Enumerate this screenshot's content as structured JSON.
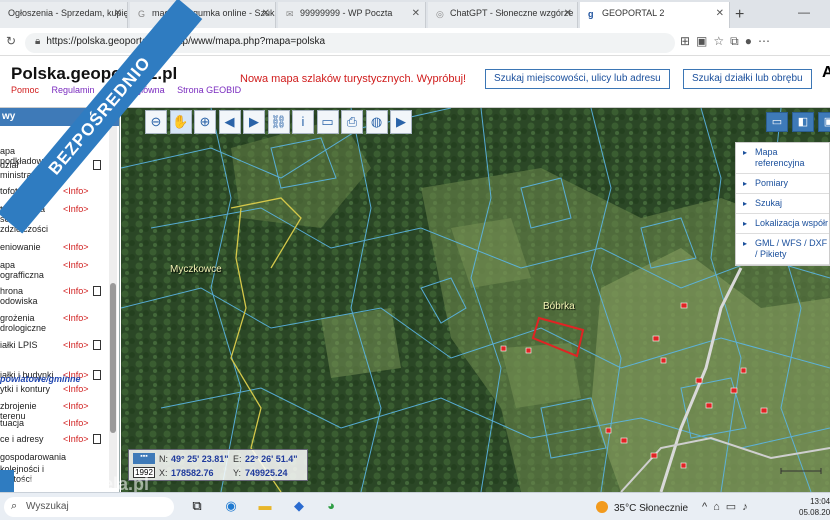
{
  "browser": {
    "tabs": [
      {
        "label": "Ogłoszenia - Sprzedam, kupię"
      },
      {
        "label": "magiczna gumka online - Szuk"
      },
      {
        "label": "99999999 - WP Poczta"
      },
      {
        "label": "ChatGPT - Słoneczne wzgórze"
      },
      {
        "label": "GEOPORTAL 2"
      }
    ],
    "new_tab": "+",
    "url": "https://polska.geoportal2.pl/map/www/mapa.php?mapa=polska"
  },
  "site": {
    "logo": "Polska.geoportal2.pl",
    "links": [
      "Pomoc",
      "Regulamin",
      "Strona główna",
      "Strona GEOBID"
    ],
    "promo": "Nowa mapa szlaków turystycznych. Wypróbuj!",
    "search_place_button": "Szukaj miejscowości, ulicy lub adresu",
    "search_parcel_button": "Szukaj działki lub obrębu",
    "header_extra": "A"
  },
  "left_panel": {
    "heading": "wy",
    "layers": [
      {
        "name": "apa podkładowa",
        "info": "<Info>",
        "doc": false
      },
      {
        "name": "dział\nministracyjny",
        "info": "",
        "doc": true
      },
      {
        "name": "tofotomapa",
        "info": "<Info>",
        "doc": false
      },
      {
        "name": "tofotomapa\nsokiej\nzdzielczości",
        "info": "<Info>",
        "doc": false
      },
      {
        "name": "eniowanie",
        "info": "<Info>",
        "doc": false
      },
      {
        "name": "apa\nografficzna",
        "info": "<Info>",
        "doc": false
      },
      {
        "name": "hrona\nodowiska",
        "info": "<Info>",
        "doc": true
      },
      {
        "name": "grożenia\ndrologiczne",
        "info": "<Info>",
        "doc": false
      },
      {
        "name": "iałki LPIS",
        "info": "<Info>",
        "doc": true
      },
      {
        "name": "iałki i budynki",
        "info": "<Info>",
        "doc": true
      },
      {
        "name": "ytki i kontury",
        "info": "<Info>",
        "doc": false
      },
      {
        "name": "zbrojenie terenu",
        "info": "<Info>",
        "doc": false
      },
      {
        "name": "tuacja",
        "info": "<Info>",
        "doc": false
      },
      {
        "name": "ce i adresy",
        "info": "<Info>",
        "doc": true
      },
      {
        "name": "gospodarowania",
        "info": "",
        "doc": false
      },
      {
        "name": "kolejności i\nzystości",
        "info": "",
        "doc": false
      }
    ],
    "section_label": "powiatowe/gminne"
  },
  "map": {
    "toolbar": [
      "zoom-out-icon",
      "hand-icon",
      "zoom-in-icon",
      "arrow-left-icon",
      "arrow-right-icon",
      "link-icon",
      "info-icon",
      "ruler-icon",
      "print-icon",
      "globe-icon",
      "camera-icon"
    ],
    "labels": {
      "village_a": "Myczkowce",
      "village_b": "Bóbrka"
    },
    "menu": [
      "Mapa referencyjna",
      "Pomiary",
      "Szukaj",
      "Lokalizacja współr",
      "GML / WFS / DXF / Pikiety"
    ],
    "coords": {
      "year": "1992",
      "n_label": "N:",
      "n_value": "49° 25' 23.81\"",
      "e_label": "E:",
      "e_value": "22° 26' 51.4\"",
      "x_label": "X:",
      "x_value": "178582.76",
      "y_label": "Y:",
      "y_value": "749925.24"
    },
    "colors": {
      "parcel_lines": "#5bb6e6",
      "boundary": "#d4c84a",
      "highlight": "#e02424"
    }
  },
  "taskbar": {
    "search_placeholder": "Wyszukaj",
    "temperature": "35°C",
    "weather": "Słonecznie",
    "time": "13:04",
    "date": "05.08.20"
  },
  "watermark": {
    "ribbon": "BEZPOŚREDNIO",
    "site": "otodzrciciela.pl"
  }
}
